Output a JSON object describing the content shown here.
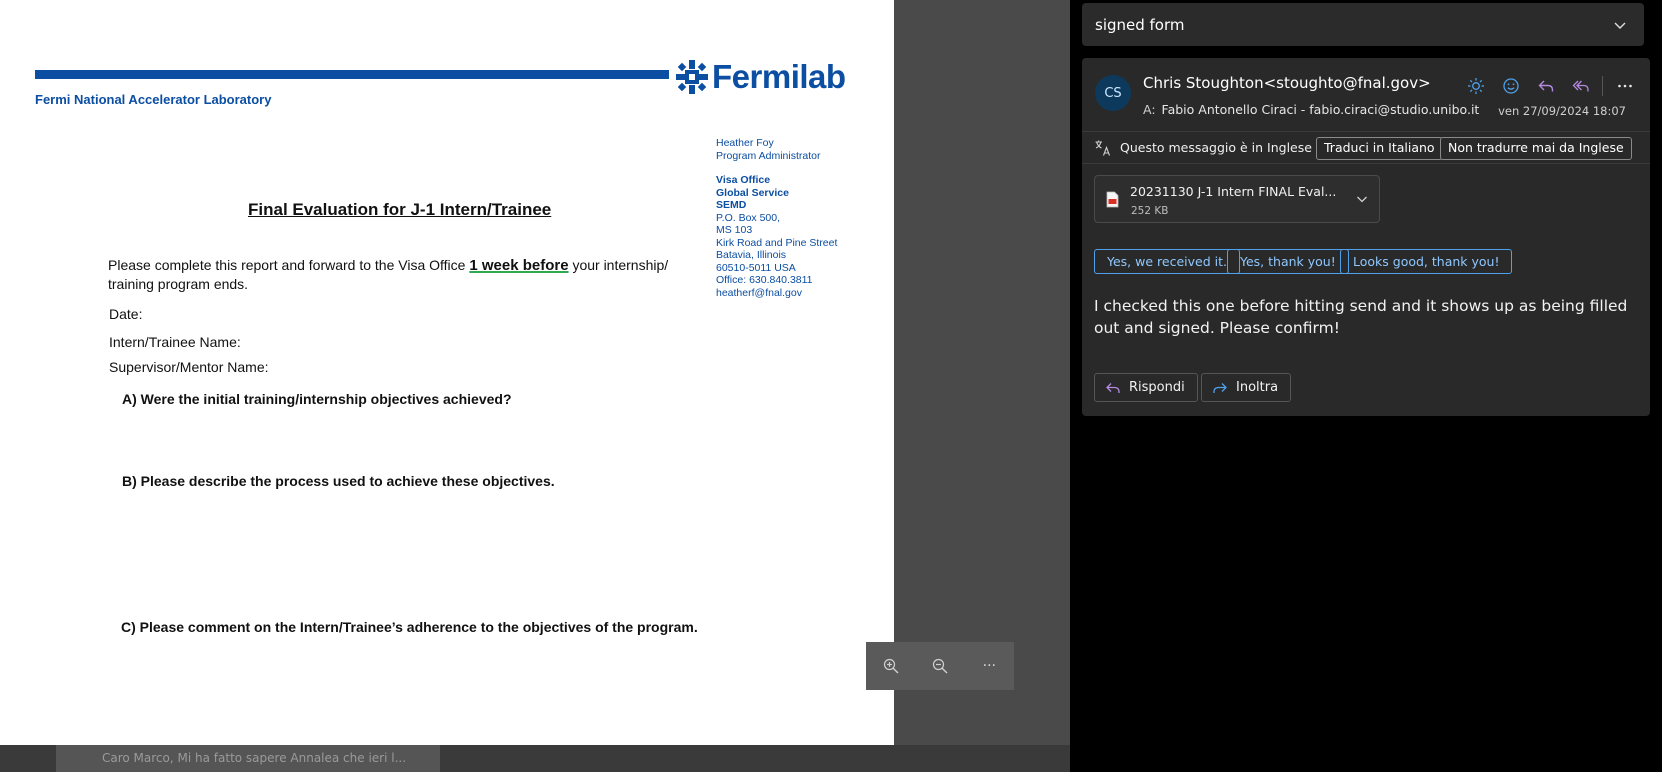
{
  "background": {
    "snippet_text": "Caro Marco, Mi ha fatto sapere Annalea che ieri l..."
  },
  "document": {
    "org_name": "Fermilab",
    "lab_name": "Fermi National Accelerator Laboratory",
    "contact": {
      "name": "Heather Foy",
      "role": "Program Administrator",
      "office_lines": [
        "Visa Office",
        "Global Service",
        "SEMD"
      ],
      "address_lines": [
        "P.O. Box 500,",
        "MS 103",
        "Kirk Road and Pine Street",
        "Batavia, Illinois",
        "60510-5011 USA",
        "Office: 630.840.3811",
        "heatherf@fnal.gov"
      ]
    },
    "title": "Final Evaluation for J-1 Intern/Trainee",
    "intro_before": "Please complete this report and forward to the Visa Office ",
    "intro_highlight": "1 week before",
    "intro_after": " your internship/ training program ends.",
    "fields": {
      "date": "Date:",
      "intern_name": "Intern/Trainee Name:",
      "supervisor_name": "Supervisor/Mentor Name:"
    },
    "questions": {
      "a": "A)  Were the initial training/internship objectives achieved?",
      "b": "B) Please describe the process used to achieve these objectives.",
      "c": "C) Please comment on the Intern/Trainee’s adherence to the objectives of the program."
    }
  },
  "zoom_bar": {
    "zoom_in_icon": "zoom-in-icon",
    "zoom_out_icon": "zoom-out-icon",
    "more_label": "···"
  },
  "reading_pane": {
    "subject": "signed form",
    "message": {
      "avatar_initials": "CS",
      "sender": "Chris Stoughton<stoughto@fnal.gov>",
      "to_label": "A:",
      "to_value": "Fabio Antonello Ciraci - fabio.ciraci@studio.unibo.it",
      "date": "ven 27/09/2024 18:07",
      "translate_notice": "Questo messaggio è in Inglese",
      "translate_button": "Traduci in Italiano",
      "never_translate_button": "Non tradurre mai da Inglese",
      "attachment": {
        "name": "20231130 J-1 Intern FINAL Eval...",
        "size": "252 KB"
      },
      "quick_replies": [
        "Yes, we received it.",
        "Yes, thank you!",
        "Looks good, thank you!"
      ],
      "body": "I checked this one before hitting send and it shows up as being filled out and signed.  Please confirm!",
      "reply_button": "Rispondi",
      "forward_button": "Inoltra"
    }
  },
  "colors": {
    "fermilab_blue": "#0b4ea2",
    "accent_blue": "#4ea1ea",
    "reply_purple": "#b48ae0",
    "pane_bg": "#000000",
    "card_bg": "#292929"
  }
}
